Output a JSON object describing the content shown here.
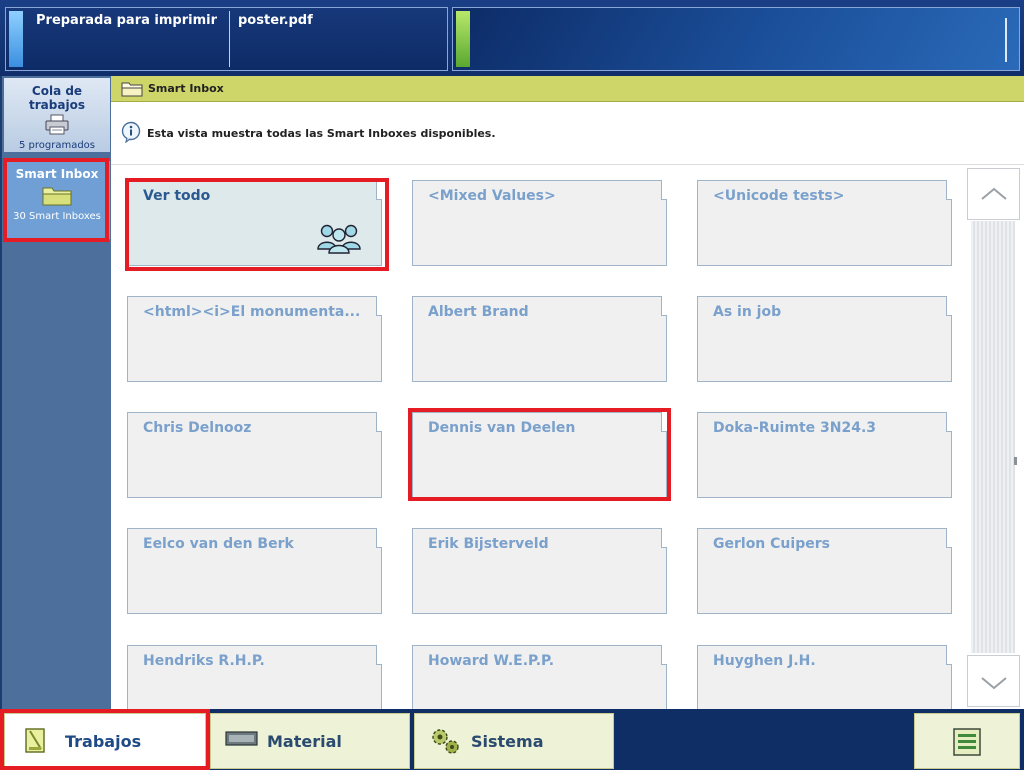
{
  "status": {
    "printer_state": "Preparada para imprimir",
    "job_name": "poster.pdf"
  },
  "leftnav": {
    "queue": {
      "title": "Cola de trabajos",
      "subtitle": "5 programados"
    },
    "inbox": {
      "title": "Smart Inbox",
      "subtitle": "30 Smart Inboxes"
    }
  },
  "breadcrumb": {
    "label": "Smart Inbox"
  },
  "info": {
    "text": "Esta vista muestra todas las Smart Inboxes disponibles."
  },
  "tiles": [
    "Ver todo",
    "<Mixed Values>",
    "<Unicode tests>",
    "<html><i>El monumenta...",
    "Albert Brand",
    "As in job",
    "Chris Delnooz",
    "Dennis van Deelen",
    "Doka-Ruimte 3N24.3",
    "Eelco van den Berk",
    "Erik Bijsterveld",
    "Gerlon Cuipers",
    "Hendriks R.H.P.",
    "Howard W.E.P.P.",
    "Huyghen J.H."
  ],
  "tabs": {
    "jobs": "Trabajos",
    "material": "Material",
    "system": "Sistema"
  },
  "icons": {
    "queue": "printer-icon",
    "inbox": "folder-icon",
    "ver_todo": "users-group-icon",
    "info": "info-icon",
    "scroll_up": "chevron-up-icon",
    "scroll_down": "chevron-down-icon",
    "jobs": "document-icon",
    "material": "media-icon",
    "system": "gears-icon",
    "menu": "menu-icon"
  },
  "colors": {
    "highlight": "#e51c23",
    "crumb_bar": "#cfd669",
    "tile_label": "#7aa0cc"
  }
}
